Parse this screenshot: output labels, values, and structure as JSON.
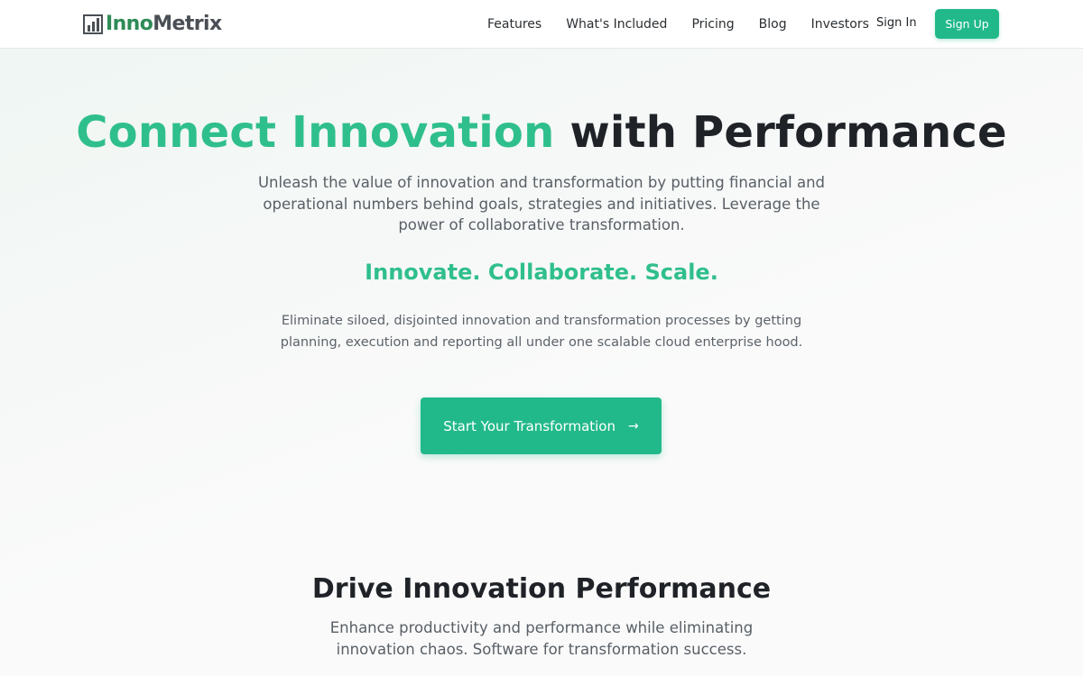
{
  "header": {
    "logo": {
      "part1": "Inno",
      "part2": "Metrix",
      "icon": "bar-chart-logo-icon",
      "color_inno": "#2e8b57",
      "color_metrix": "#4a4f55"
    },
    "nav": [
      {
        "label": "Features"
      },
      {
        "label": "What's Included"
      },
      {
        "label": "Pricing"
      },
      {
        "label": "Blog"
      },
      {
        "label": "Investors"
      }
    ],
    "sign_in_label": "Sign In",
    "sign_up_label": "Sign Up"
  },
  "hero": {
    "title_accent": "Connect Innovation",
    "title_rest": "with Performance",
    "subtitle": "Unleash the value of innovation and transformation by putting financial and operational numbers behind goals, strategies and initiatives. Leverage the power of collaborative transformation.",
    "tagline": "Innovate. Collaborate. Scale.",
    "description": "Eliminate siloed, disjointed innovation and transformation processes by getting planning, execution and reporting all under one scalable cloud enterprise hood.",
    "cta_label": "Start Your Transformation",
    "cta_icon": "arrow-right-icon"
  },
  "section": {
    "title": "Drive Innovation Performance",
    "subtitle": "Enhance productivity and performance while eliminating innovation chaos. Software for transformation success."
  },
  "colors": {
    "accent": "#22b98a",
    "accent_text": "#2fbf8c",
    "heading": "#1f2328",
    "body_text": "#585f66"
  }
}
